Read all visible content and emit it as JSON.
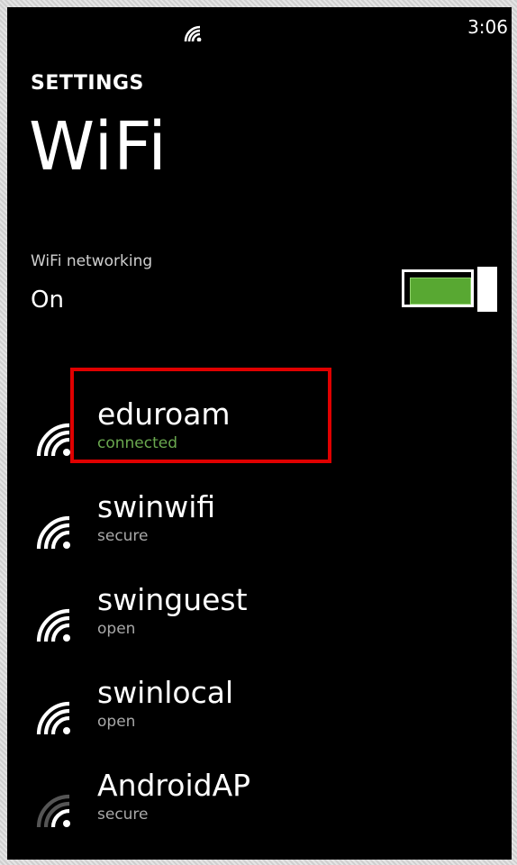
{
  "status_bar": {
    "signal_icon": "wifi-signal-icon",
    "time": "3:06"
  },
  "header": {
    "section": "SETTINGS",
    "title": "WiFi"
  },
  "wifi_toggle": {
    "label": "WiFi networking",
    "state": "On",
    "enabled": true,
    "accent_color": "#58a832"
  },
  "networks": [
    {
      "name": "eduroam",
      "status": "connected",
      "icon": "wifi-signal-icon",
      "highlighted": true
    },
    {
      "name": "swinwifi",
      "status": "secure",
      "icon": "wifi-signal-icon"
    },
    {
      "name": "swinguest",
      "status": "open",
      "icon": "wifi-signal-icon"
    },
    {
      "name": "swinlocal",
      "status": "open",
      "icon": "wifi-signal-icon"
    },
    {
      "name": "AndroidAP",
      "status": "secure",
      "icon": "wifi-signal-icon-weak"
    }
  ],
  "colors": {
    "connected": "#6aa84f",
    "highlight": "#e00000"
  }
}
